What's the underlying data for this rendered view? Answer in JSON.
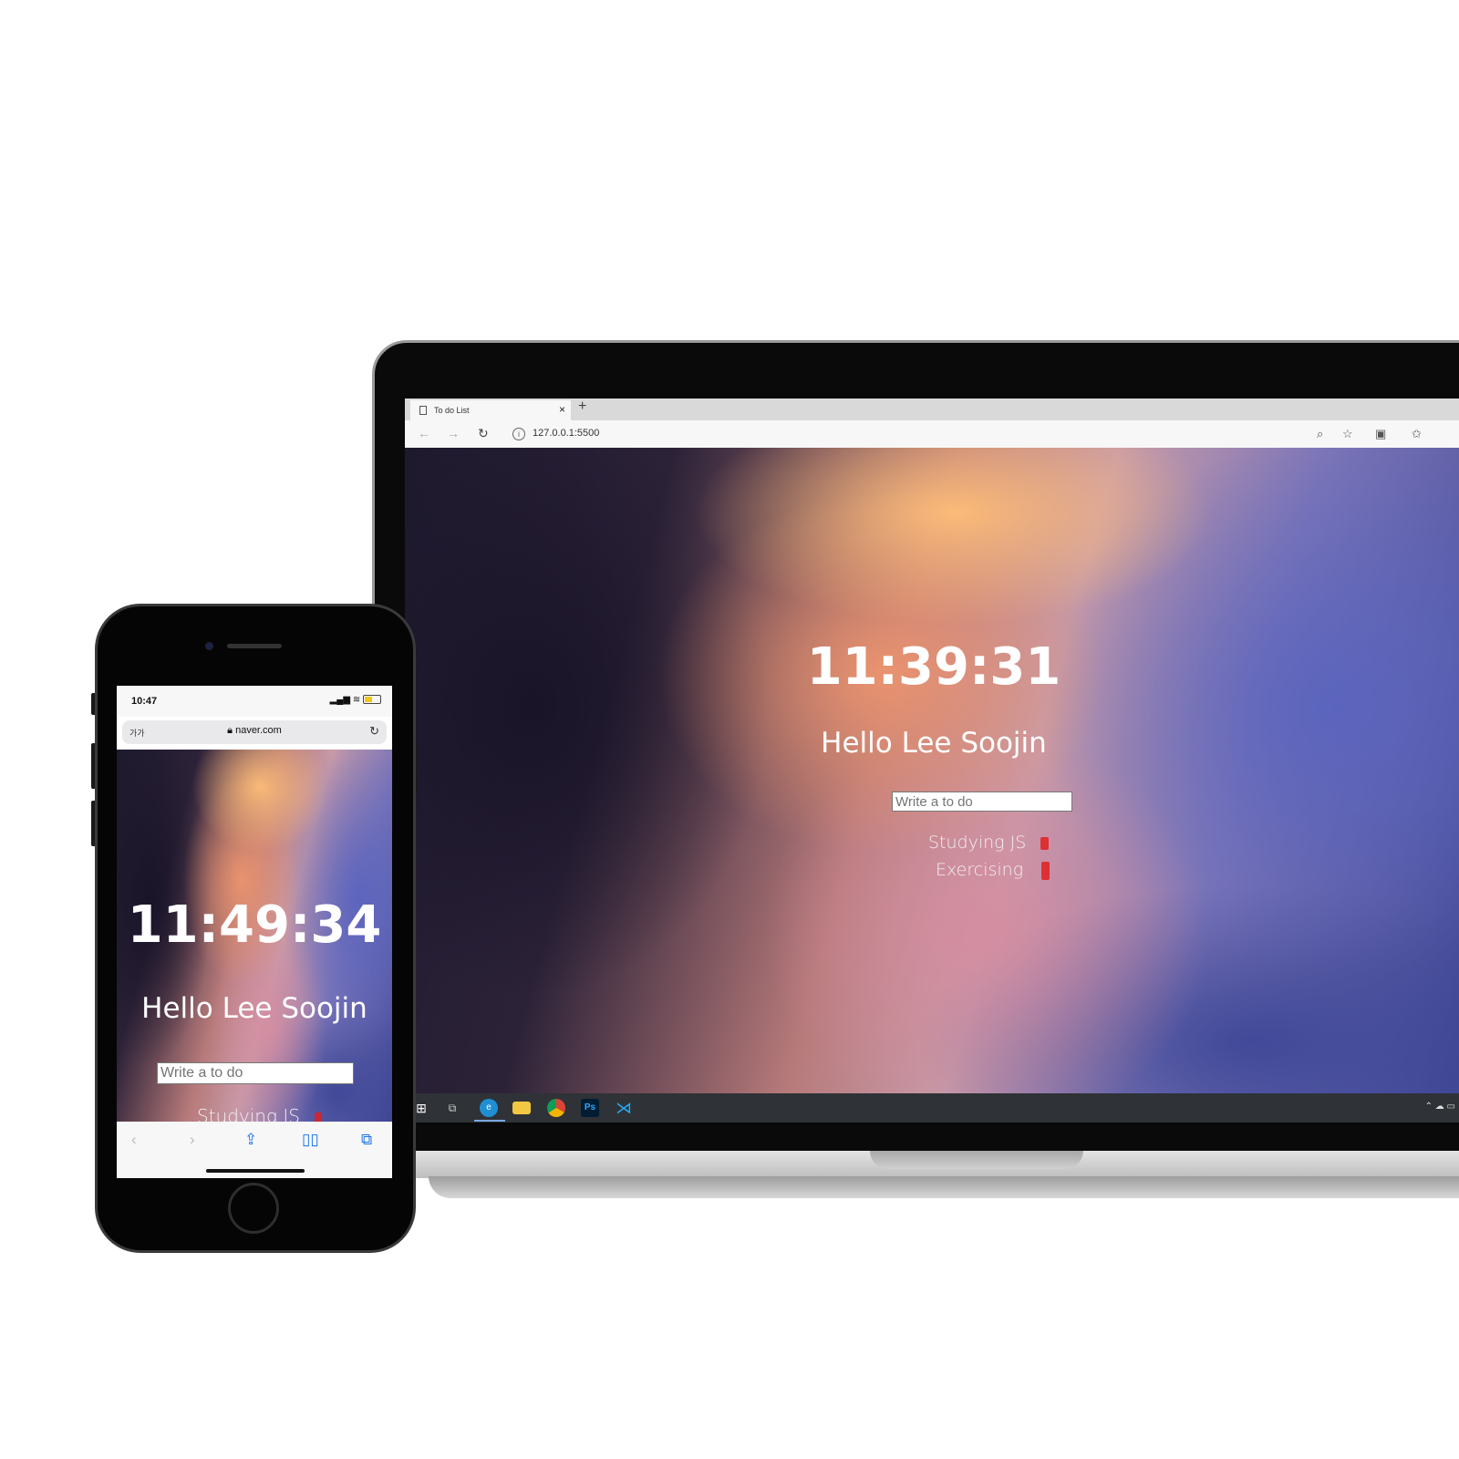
{
  "laptop": {
    "browser": {
      "tab_title": "To do List",
      "tab_close": "×",
      "new_tab": "+",
      "url": "127.0.0.1:5500"
    },
    "page": {
      "clock": "11:39:31",
      "greeting": "Hello Lee Soojin",
      "input_placeholder": "Write a to do",
      "todos": [
        "Studying JS",
        "Exercising"
      ]
    },
    "taskbar_icons": [
      "windows-start",
      "task-view",
      "edge",
      "file-explorer",
      "chrome",
      "photoshop",
      "vscode"
    ],
    "taskbar_ps_label": "Ps"
  },
  "phone": {
    "status_time": "10:47",
    "addr_aa": "가가",
    "url": "naver.com",
    "page": {
      "clock": "11:49:34",
      "greeting": "Hello Lee Soojin",
      "input_placeholder": "Write a to do",
      "todos": [
        "Studying JS"
      ]
    }
  },
  "colors": {
    "trash": "#e02020",
    "taskbar": "#2f3236",
    "edge": "#1f8fd4",
    "vscode": "#23a8f2",
    "photoshop": "#001d34"
  }
}
